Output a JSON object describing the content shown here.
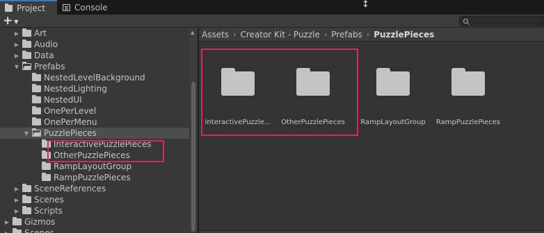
{
  "tabs": [
    {
      "label": "Project",
      "icon": "folder-icon",
      "active": true
    },
    {
      "label": "Console",
      "icon": "console-icon",
      "active": false
    }
  ],
  "toolbar": {
    "add_label": "+",
    "add_icon": "plus-icon",
    "search_placeholder": ""
  },
  "tree": {
    "rows": [
      {
        "label": "Art",
        "depth": 2,
        "expanded": false
      },
      {
        "label": "Audio",
        "depth": 2,
        "expanded": false
      },
      {
        "label": "Data",
        "depth": 2,
        "expanded": false
      },
      {
        "label": "Prefabs",
        "depth": 2,
        "expanded": true
      },
      {
        "label": "NestedLevelBackground",
        "depth": 3,
        "expanded": null
      },
      {
        "label": "NestedLighting",
        "depth": 3,
        "expanded": null
      },
      {
        "label": "NestedUI",
        "depth": 3,
        "expanded": null
      },
      {
        "label": "OnePerLevel",
        "depth": 3,
        "expanded": null
      },
      {
        "label": "OnePerMenu",
        "depth": 3,
        "expanded": null
      },
      {
        "label": "PuzzlePieces",
        "depth": 3,
        "expanded": true,
        "selected": true
      },
      {
        "label": "InteractivePuzzlePieces",
        "depth": 4,
        "expanded": null
      },
      {
        "label": "OtherPuzzlePieces",
        "depth": 4,
        "expanded": null
      },
      {
        "label": "RampLayoutGroup",
        "depth": 4,
        "expanded": null
      },
      {
        "label": "RampPuzzlePieces",
        "depth": 4,
        "expanded": null
      },
      {
        "label": "SceneReferences",
        "depth": 2,
        "expanded": false
      },
      {
        "label": "Scenes",
        "depth": 2,
        "expanded": false
      },
      {
        "label": "Scripts",
        "depth": 2,
        "expanded": false
      },
      {
        "label": "Gizmos",
        "depth": 1,
        "expanded": false
      },
      {
        "label": "Scenes",
        "depth": 1,
        "expanded": false
      }
    ]
  },
  "breadcrumb": [
    "Assets",
    "Creator Kit - Puzzle",
    "Prefabs",
    "PuzzlePieces"
  ],
  "grid": [
    {
      "label": "InteractivePuzzle..."
    },
    {
      "label": "OtherPuzzlePieces"
    },
    {
      "label": "RampLayoutGroup"
    },
    {
      "label": "RampPuzzlePieces"
    }
  ],
  "colors": {
    "highlight": "#d6285c",
    "accent": "#3a79bb"
  }
}
